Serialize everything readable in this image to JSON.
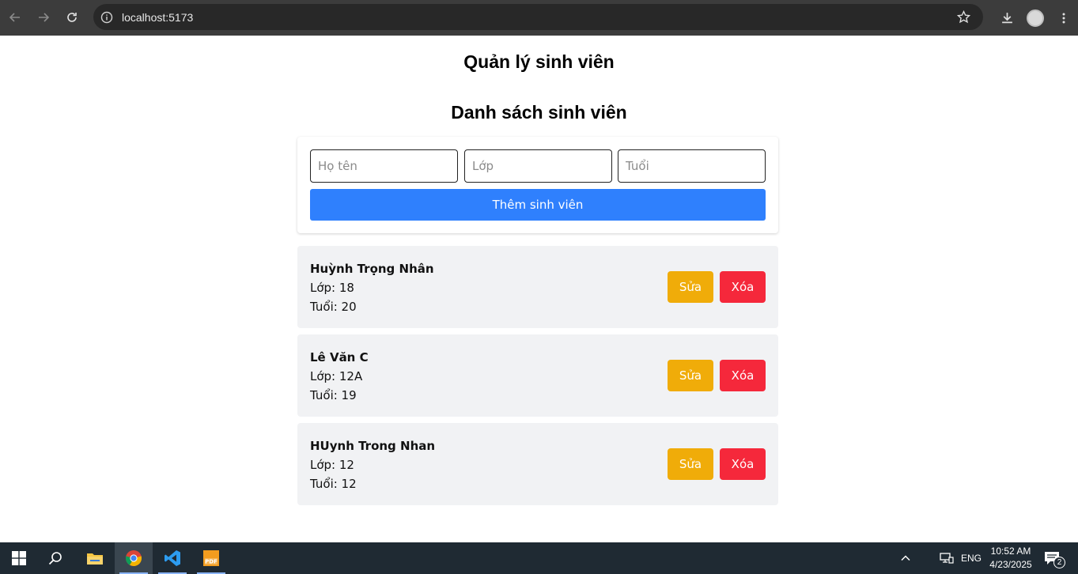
{
  "browser": {
    "url": "localhost:5173"
  },
  "page": {
    "app_title": "Quản lý sinh viên",
    "list_title": "Danh sách sinh viên"
  },
  "form": {
    "name_placeholder": "Họ tên",
    "class_placeholder": "Lớp",
    "age_placeholder": "Tuổi",
    "add_button": "Thêm sinh viên"
  },
  "students": [
    {
      "name": "Huỳnh Trọng Nhân",
      "class": "Lớp: 18",
      "age": "Tuổi: 20",
      "edit": "Sửa",
      "delete": "Xóa"
    },
    {
      "name": "Lê Văn C",
      "class": "Lớp: 12A",
      "age": "Tuổi: 19",
      "edit": "Sửa",
      "delete": "Xóa"
    },
    {
      "name": "HUynh Trong Nhan",
      "class": "Lớp: 12",
      "age": "Tuổi: 12",
      "edit": "Sửa",
      "delete": "Xóa"
    }
  ],
  "taskbar": {
    "language": "ENG",
    "time": "10:52 AM",
    "date": "4/23/2025",
    "notification_count": "2"
  },
  "colors": {
    "primary": "#2f80fd",
    "edit": "#f0ac09",
    "delete": "#f5283b",
    "card": "#f1f2f4"
  }
}
